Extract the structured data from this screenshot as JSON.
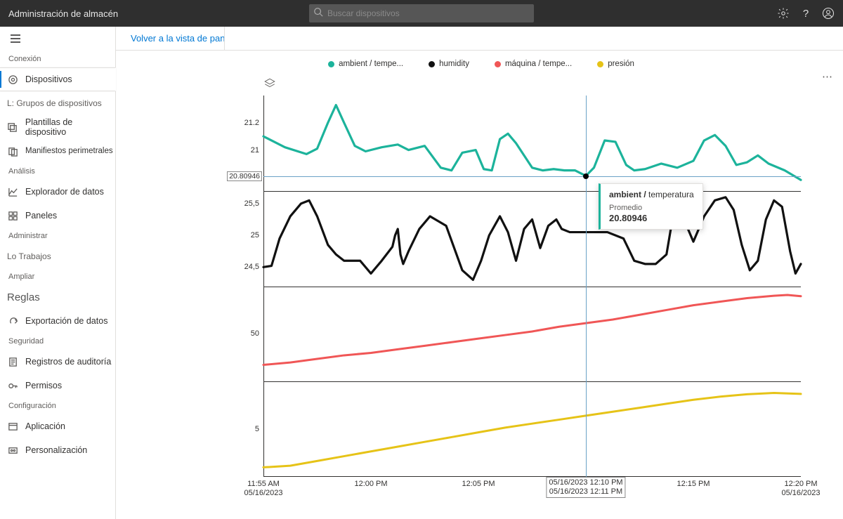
{
  "header": {
    "title": "Administración de almacén",
    "search_placeholder": "Buscar dispositivos"
  },
  "sidebar": {
    "sections": {
      "connection": "Conexión",
      "analysis": "Análisis",
      "administer": "Administrar",
      "extend": "Ampliar",
      "security": "Seguridad",
      "configuration": "Configuración"
    },
    "items": {
      "devices": "Dispositivos",
      "device_groups": "L: Grupos de dispositivos",
      "device_templates": "Plantillas de dispositivo",
      "edge_manifests": "Manifiestos perimetrales",
      "data_explorer": "Explorador de datos",
      "dashboards": "Paneles",
      "jobs": "Lo Trabajos",
      "rules": "Reglas",
      "data_export": "Exportación de datos",
      "audit_logs": "Registros de auditoría",
      "permissions": "Permisos",
      "application": "Aplicación",
      "customization": "Personalización"
    }
  },
  "back_label": "Volver a la vista de panel",
  "colors": {
    "ambient": "#1cb39b",
    "humidity": "#111111",
    "machine": "#f05656",
    "pressure": "#e6c317"
  },
  "legend": {
    "ambient": "ambient / tempe...",
    "humidity": "humidity",
    "machine": "máquina / tempe...",
    "pressure": "presión"
  },
  "tooltip": {
    "series_prefix": "ambient / ",
    "series_suffix": "temperatura",
    "stat_label": "Promedio",
    "value": "20.80946"
  },
  "crosshair": {
    "y_label": "20.80946",
    "x_line1": "05/16/2023 12:10 PM",
    "x_line2": "05/16/2023 12:11 PM"
  },
  "chart_data": [
    {
      "type": "line",
      "name": "ambient / temperatura",
      "ylim": [
        20.7,
        21.4
      ],
      "yticks": [
        21,
        21.2
      ],
      "ylabel": "",
      "x_fraction_of_range": true,
      "points": [
        [
          0.0,
          21.1
        ],
        [
          0.04,
          21.02
        ],
        [
          0.08,
          20.97
        ],
        [
          0.1,
          21.01
        ],
        [
          0.12,
          21.2
        ],
        [
          0.135,
          21.33
        ],
        [
          0.15,
          21.2
        ],
        [
          0.17,
          21.03
        ],
        [
          0.19,
          20.99
        ],
        [
          0.22,
          21.02
        ],
        [
          0.25,
          21.04
        ],
        [
          0.27,
          21.0
        ],
        [
          0.3,
          21.03
        ],
        [
          0.33,
          20.87
        ],
        [
          0.35,
          20.85
        ],
        [
          0.37,
          20.98
        ],
        [
          0.395,
          21.0
        ],
        [
          0.41,
          20.86
        ],
        [
          0.425,
          20.85
        ],
        [
          0.44,
          21.08
        ],
        [
          0.455,
          21.12
        ],
        [
          0.47,
          21.05
        ],
        [
          0.5,
          20.87
        ],
        [
          0.52,
          20.85
        ],
        [
          0.54,
          20.86
        ],
        [
          0.56,
          20.85
        ],
        [
          0.58,
          20.85
        ],
        [
          0.6,
          20.81
        ],
        [
          0.615,
          20.87
        ],
        [
          0.635,
          21.07
        ],
        [
          0.655,
          21.06
        ],
        [
          0.675,
          20.89
        ],
        [
          0.69,
          20.85
        ],
        [
          0.71,
          20.86
        ],
        [
          0.74,
          20.9
        ],
        [
          0.77,
          20.87
        ],
        [
          0.8,
          20.92
        ],
        [
          0.82,
          21.07
        ],
        [
          0.84,
          21.11
        ],
        [
          0.86,
          21.03
        ],
        [
          0.88,
          20.89
        ],
        [
          0.9,
          20.91
        ],
        [
          0.92,
          20.96
        ],
        [
          0.94,
          20.9
        ],
        [
          0.97,
          20.85
        ],
        [
          1.0,
          20.78
        ]
      ]
    },
    {
      "type": "line",
      "name": "humidity",
      "ylim": [
        24.2,
        25.7
      ],
      "yticks": [
        24.5,
        25,
        25.5
      ],
      "ylabel": "",
      "points": [
        [
          0.0,
          24.5
        ],
        [
          0.015,
          24.52
        ],
        [
          0.03,
          24.95
        ],
        [
          0.05,
          25.3
        ],
        [
          0.07,
          25.5
        ],
        [
          0.085,
          25.55
        ],
        [
          0.1,
          25.3
        ],
        [
          0.12,
          24.85
        ],
        [
          0.135,
          24.7
        ],
        [
          0.15,
          24.6
        ],
        [
          0.18,
          24.6
        ],
        [
          0.2,
          24.4
        ],
        [
          0.22,
          24.6
        ],
        [
          0.24,
          24.82
        ],
        [
          0.245,
          25.0
        ],
        [
          0.25,
          25.1
        ],
        [
          0.255,
          24.7
        ],
        [
          0.26,
          24.55
        ],
        [
          0.27,
          24.75
        ],
        [
          0.29,
          25.1
        ],
        [
          0.31,
          25.3
        ],
        [
          0.34,
          25.15
        ],
        [
          0.37,
          24.45
        ],
        [
          0.39,
          24.3
        ],
        [
          0.405,
          24.6
        ],
        [
          0.42,
          25.0
        ],
        [
          0.44,
          25.3
        ],
        [
          0.455,
          25.05
        ],
        [
          0.47,
          24.6
        ],
        [
          0.485,
          25.1
        ],
        [
          0.5,
          25.25
        ],
        [
          0.515,
          24.8
        ],
        [
          0.53,
          25.15
        ],
        [
          0.545,
          25.25
        ],
        [
          0.555,
          25.1
        ],
        [
          0.57,
          25.05
        ],
        [
          0.59,
          25.05
        ],
        [
          0.61,
          25.05
        ],
        [
          0.64,
          25.05
        ],
        [
          0.67,
          24.95
        ],
        [
          0.69,
          24.6
        ],
        [
          0.71,
          24.55
        ],
        [
          0.73,
          24.55
        ],
        [
          0.75,
          24.7
        ],
        [
          0.76,
          25.2
        ],
        [
          0.77,
          25.45
        ],
        [
          0.785,
          25.2
        ],
        [
          0.8,
          24.9
        ],
        [
          0.82,
          25.3
        ],
        [
          0.84,
          25.55
        ],
        [
          0.86,
          25.6
        ],
        [
          0.875,
          25.4
        ],
        [
          0.89,
          24.85
        ],
        [
          0.905,
          24.45
        ],
        [
          0.92,
          24.6
        ],
        [
          0.935,
          25.25
        ],
        [
          0.95,
          25.55
        ],
        [
          0.965,
          25.45
        ],
        [
          0.98,
          24.75
        ],
        [
          0.99,
          24.4
        ],
        [
          1.0,
          24.55
        ]
      ]
    },
    {
      "type": "line",
      "name": "máquina / temperatura",
      "ylim": [
        30,
        70
      ],
      "yticks": [
        50
      ],
      "ylabel": "",
      "points": [
        [
          0.0,
          37
        ],
        [
          0.05,
          38
        ],
        [
          0.1,
          39.5
        ],
        [
          0.15,
          41
        ],
        [
          0.2,
          42
        ],
        [
          0.25,
          43.5
        ],
        [
          0.3,
          45
        ],
        [
          0.35,
          46.5
        ],
        [
          0.4,
          48
        ],
        [
          0.45,
          49.5
        ],
        [
          0.5,
          51
        ],
        [
          0.55,
          53
        ],
        [
          0.6,
          54.5
        ],
        [
          0.65,
          56
        ],
        [
          0.7,
          58
        ],
        [
          0.75,
          60
        ],
        [
          0.8,
          62
        ],
        [
          0.85,
          63.5
        ],
        [
          0.9,
          65
        ],
        [
          0.95,
          66
        ],
        [
          0.975,
          66.3
        ],
        [
          1.0,
          65.8
        ]
      ]
    },
    {
      "type": "line",
      "name": "presión",
      "ylim": [
        2,
        8
      ],
      "yticks": [
        5
      ],
      "ylabel": "",
      "points": [
        [
          0.0,
          2.6
        ],
        [
          0.05,
          2.7
        ],
        [
          0.1,
          3.0
        ],
        [
          0.15,
          3.3
        ],
        [
          0.2,
          3.6
        ],
        [
          0.25,
          3.9
        ],
        [
          0.3,
          4.2
        ],
        [
          0.35,
          4.5
        ],
        [
          0.4,
          4.8
        ],
        [
          0.45,
          5.1
        ],
        [
          0.5,
          5.35
        ],
        [
          0.55,
          5.6
        ],
        [
          0.6,
          5.85
        ],
        [
          0.65,
          6.1
        ],
        [
          0.7,
          6.35
        ],
        [
          0.75,
          6.6
        ],
        [
          0.8,
          6.85
        ],
        [
          0.85,
          7.05
        ],
        [
          0.9,
          7.2
        ],
        [
          0.95,
          7.28
        ],
        [
          1.0,
          7.22
        ]
      ]
    }
  ],
  "xaxis": {
    "ticks": [
      {
        "pos": 0.0,
        "line1": "11:55 AM",
        "line2": "05/16/2023"
      },
      {
        "pos": 0.2,
        "line1": "12:00 PM",
        "line2": ""
      },
      {
        "pos": 0.4,
        "line1": "12:05 PM",
        "line2": ""
      },
      {
        "pos": 0.8,
        "line1": "12:15 PM",
        "line2": ""
      },
      {
        "pos": 1.0,
        "line1": "12:20 PM",
        "line2": "05/16/2023"
      }
    ]
  }
}
